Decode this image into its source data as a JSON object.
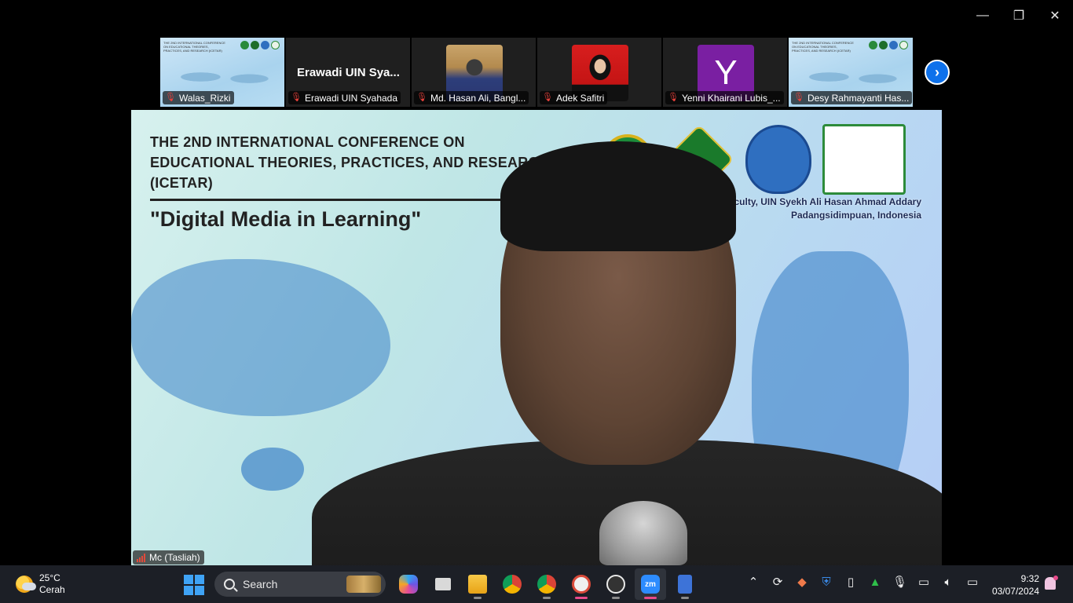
{
  "window_controls": {
    "minimize": "—",
    "restore": "❐",
    "close": "✕"
  },
  "participants": [
    {
      "name": "Walas_Rizki",
      "type": "screen-share"
    },
    {
      "name": "Erawadi UIN Syahada",
      "display_text": "Erawadi  UIN  Sya...",
      "type": "name-only"
    },
    {
      "name": "Md. Hasan Ali, Bangl...",
      "type": "photo"
    },
    {
      "name": "Adek Safitri",
      "type": "photo"
    },
    {
      "name": "Yenni Khairani Lubis_...",
      "type": "letter",
      "letter": "Y",
      "color": "#7a1fa2"
    },
    {
      "name": "Desy Rahmayanti Has...",
      "type": "screen-share"
    }
  ],
  "share_thumbnail": {
    "title": "THE 2ND INTERNATIONAL CONFERENCE ON EDUCATIONAL THEORIES, PRACTICES, AND RESEARCH (ICETAR)",
    "subtitle": "\"Digital Media in Learning\""
  },
  "main_video": {
    "background_title_line1": "THE 2ND INTERNATIONAL CONFERENCE ON",
    "background_title_line2": "EDUCATIONAL THEORIES, PRACTICES, AND RESEARCH",
    "background_title_line3": "(ICETAR)",
    "background_subtitle": "\"Digital Media in Learning\"",
    "faculty_line1": "raining Faculty, UIN Syekh Ali Hasan Ahmad Addary",
    "faculty_line2": "Padangsidimpuan, Indonesia",
    "speaker_label": "Mc (Tasliah)"
  },
  "taskbar": {
    "weather_temp": "25°C",
    "weather_desc": "Cerah",
    "search_placeholder": "Search",
    "time": "9:32",
    "date": "03/07/2024",
    "zoom_label": "zm",
    "tray_icons": [
      "chevron-up-icon",
      "sync-icon",
      "app-icon",
      "defender-icon",
      "usb-icon",
      "drive-icon",
      "microphone-icon",
      "network-icon",
      "volume-icon",
      "battery-icon"
    ]
  },
  "colors": {
    "accent": "#0e71eb",
    "mute": "#e8413b",
    "taskbar": "#1c1f26"
  }
}
